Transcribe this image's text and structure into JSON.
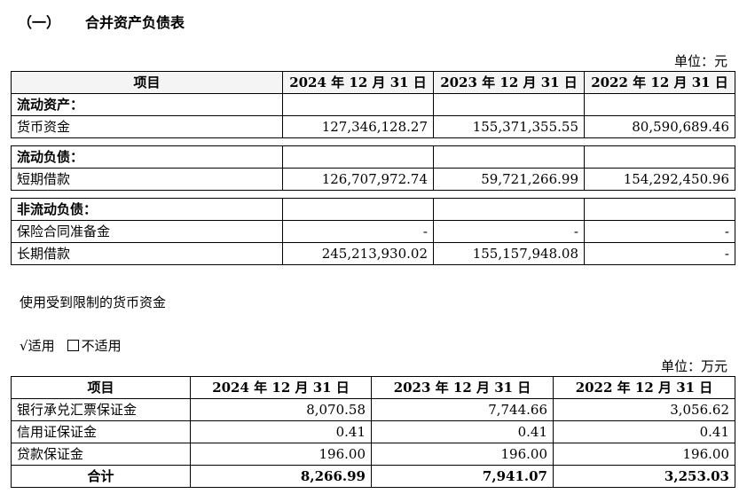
{
  "heading": {
    "number": "（一）",
    "title": "合并资产负债表"
  },
  "table1": {
    "unit": "单位：元",
    "headers": [
      "项目",
      "2024 年 12 月 31 日",
      "2023 年 12 月 31 日",
      "2022 年 12 月 31 日"
    ],
    "sections": [
      {
        "title": "流动资产：",
        "rows": [
          {
            "label": "货币资金",
            "values": [
              "127,346,128.27",
              "155,371,355.55",
              "80,590,689.46"
            ]
          }
        ]
      },
      {
        "title": "流动负债：",
        "rows": [
          {
            "label": "短期借款",
            "values": [
              "126,707,972.74",
              "59,721,266.99",
              "154,292,450.96"
            ]
          }
        ]
      },
      {
        "title": "非流动负债：",
        "rows": [
          {
            "label": "保险合同准备金",
            "values": [
              "-",
              "-",
              "-"
            ]
          },
          {
            "label": "长期借款",
            "values": [
              "245,213,930.02",
              "155,157,948.08",
              "-"
            ]
          }
        ]
      }
    ]
  },
  "note": "使用受到限制的货币资金",
  "applicability": {
    "checked_mark": "√",
    "checked_label": "适用",
    "unchecked_label": "不适用"
  },
  "table2": {
    "unit": "单位：万元",
    "headers": [
      "项目",
      "2024 年 12 月 31 日",
      "2023 年 12 月 31 日",
      "2022 年 12 月 31 日"
    ],
    "rows": [
      {
        "label": "银行承兑汇票保证金",
        "values": [
          "8,070.58",
          "7,744.66",
          "3,056.62"
        ]
      },
      {
        "label": "信用证保证金",
        "values": [
          "0.41",
          "0.41",
          "0.41"
        ]
      },
      {
        "label": "贷款保证金",
        "values": [
          "196.00",
          "196.00",
          "196.00"
        ]
      }
    ],
    "total": {
      "label": "合计",
      "values": [
        "8,266.99",
        "7,941.07",
        "3,253.03"
      ]
    }
  }
}
